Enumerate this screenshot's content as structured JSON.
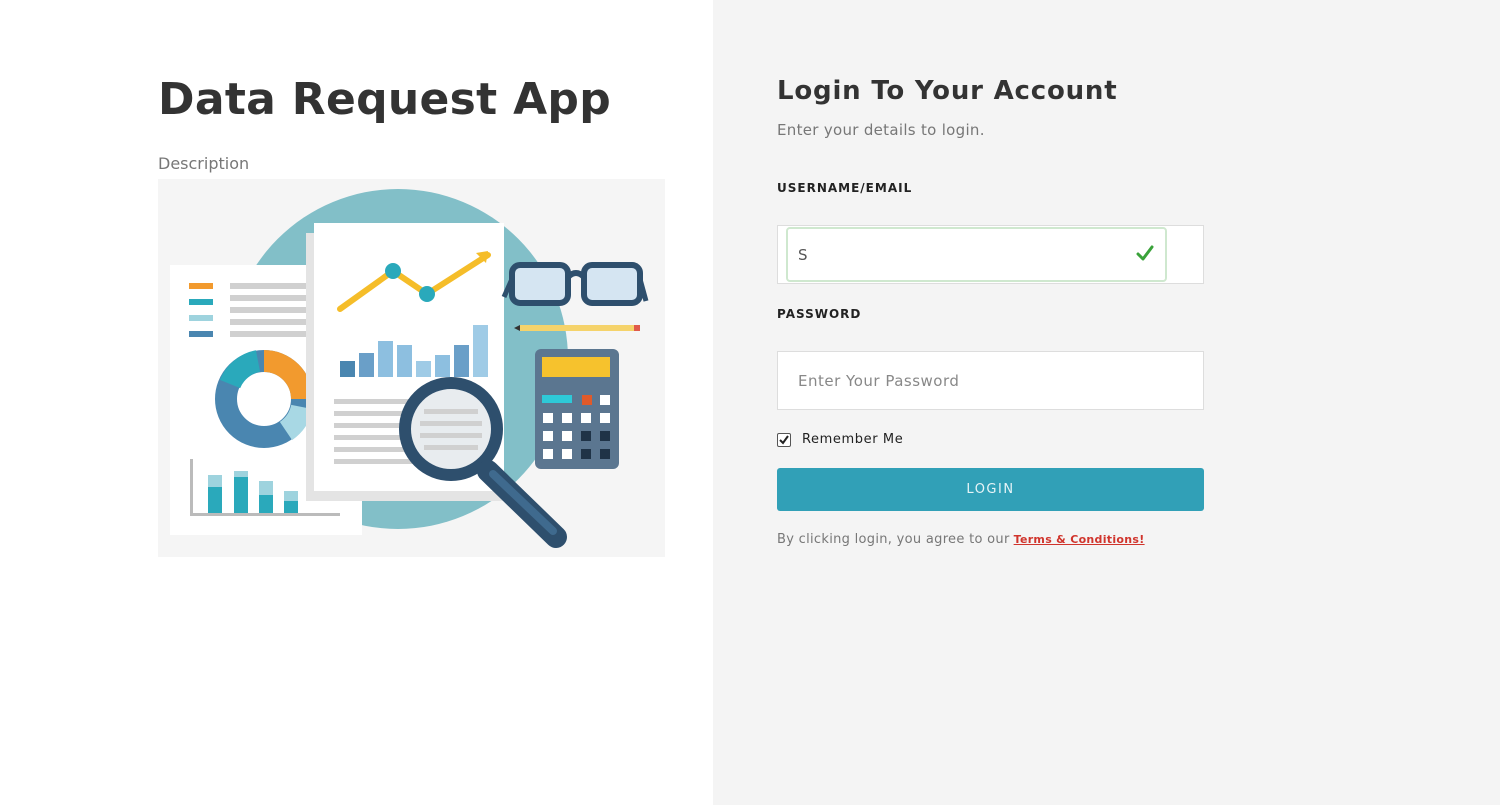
{
  "app": {
    "title": "Data Request App",
    "description": "Description"
  },
  "login": {
    "title": "Login To Your Account",
    "subtitle": "Enter your details to login.",
    "username_label": "USERNAME/EMAIL",
    "username_value": "S",
    "password_label": "PASSWORD",
    "password_placeholder": "Enter Your Password",
    "remember_label": "Remember Me",
    "remember_checked": true,
    "button_label": "LOGIN",
    "terms_prefix": "By clicking login, you agree to our",
    "terms_link": "Terms & Conditions!"
  },
  "colors": {
    "accent": "#31a0b7",
    "link": "#d0342c",
    "valid": "#3aa23a",
    "panel_bg": "#f4f4f4"
  },
  "icons": {
    "username_status": "check-icon",
    "remember_box": "checkbox-checked-icon"
  }
}
